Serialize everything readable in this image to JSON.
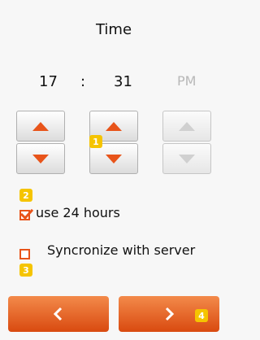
{
  "screen": {
    "title": "Time"
  },
  "time": {
    "hour": "17",
    "separator": ":",
    "minute": "31",
    "ampm": "PM"
  },
  "badges": {
    "b1": "1",
    "b2": "2",
    "b3": "3",
    "b4": "4"
  },
  "options": {
    "use_24_hours": {
      "label": "use 24 hours",
      "checked": true
    },
    "sync_server": {
      "label": "Syncronize with server",
      "checked": false
    }
  },
  "colors": {
    "accent": "#e8541a",
    "badge": "#f5c400",
    "disabled": "#c8c8c8"
  },
  "icons": {
    "hour_up": "triangle-up-icon",
    "hour_down": "triangle-down-icon",
    "minute_up": "triangle-up-icon",
    "minute_down": "triangle-down-icon",
    "ampm_up": "triangle-up-icon",
    "ampm_down": "triangle-down-icon",
    "check": "checkmark-icon",
    "back": "chevron-left-icon",
    "next": "chevron-right-icon"
  }
}
